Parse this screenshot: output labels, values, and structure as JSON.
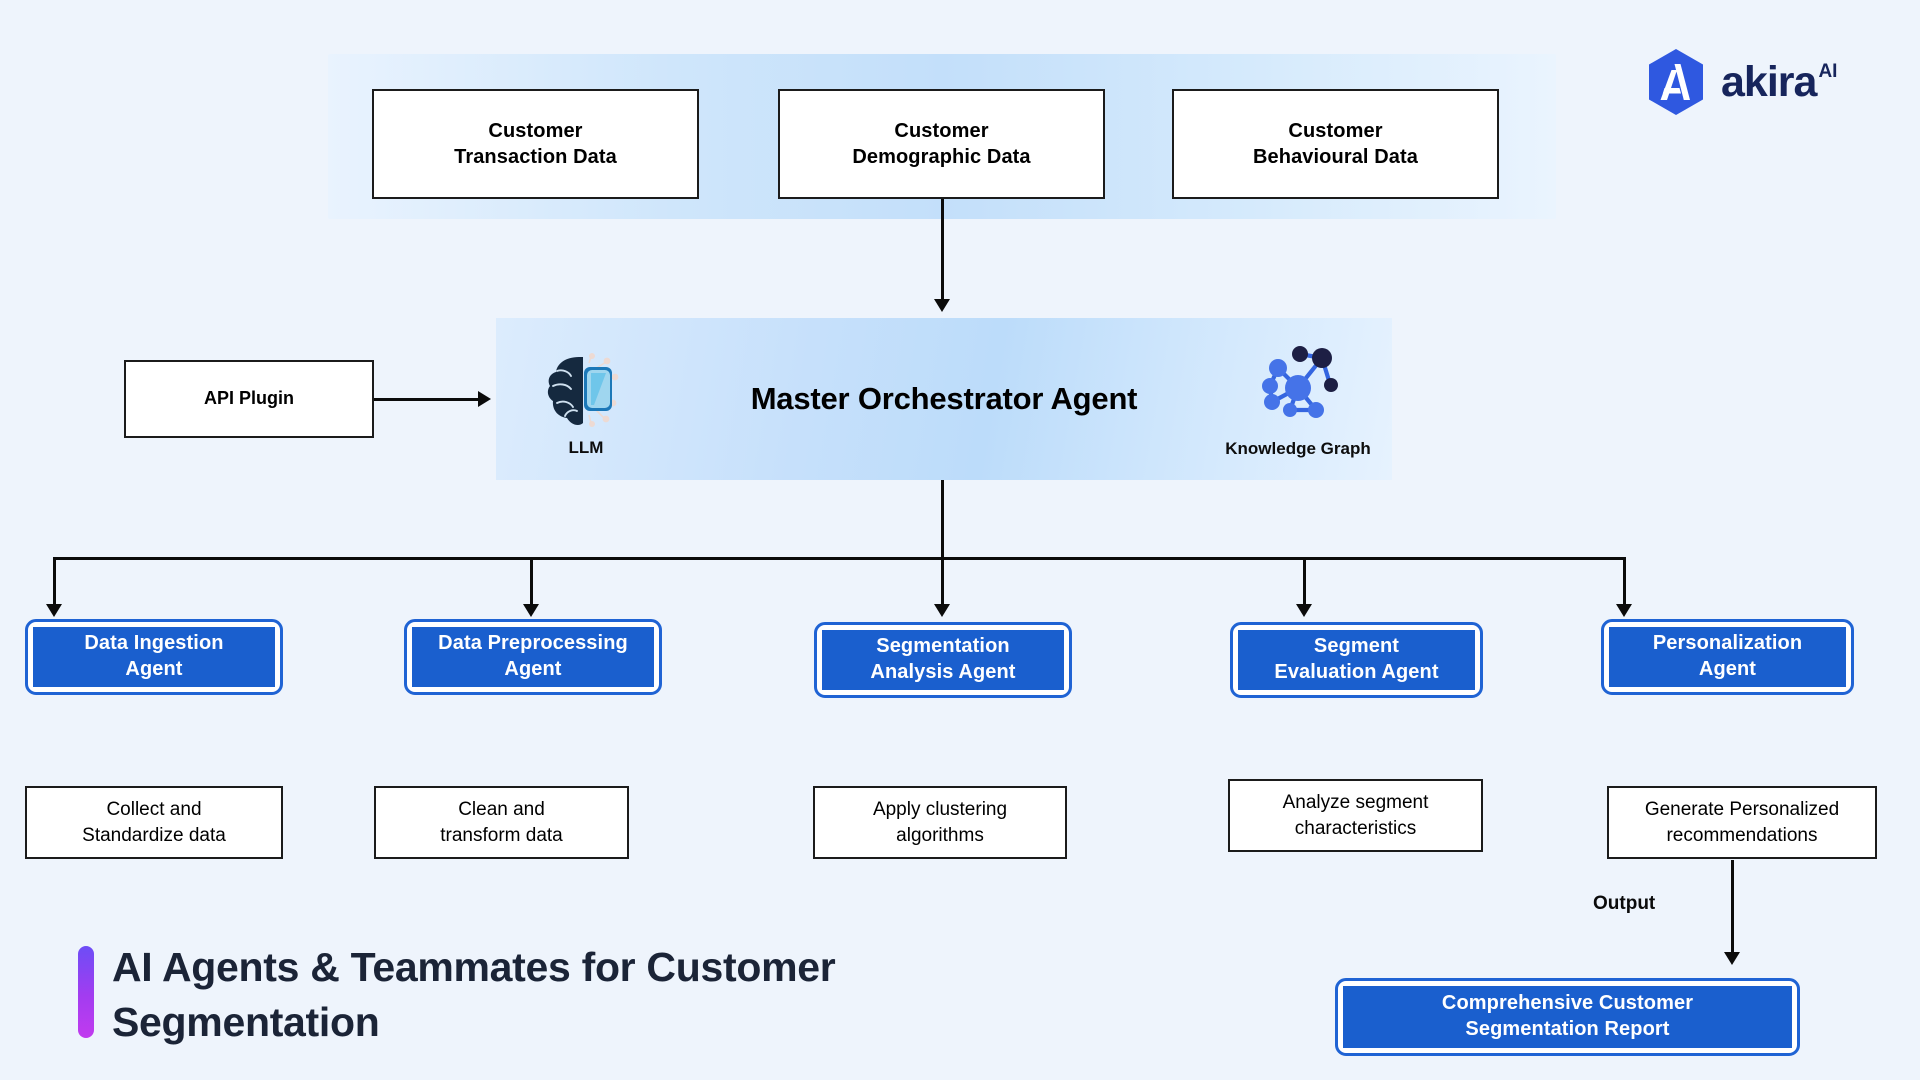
{
  "brand": {
    "name": "akira",
    "superscript": "AI",
    "logo_icon": "akira-hexagon-logo",
    "hex_color": "#2f58e0",
    "text_color": "#17255c"
  },
  "footer": {
    "title": "AI Agents & Teammates for Customer Segmentation",
    "accent_gradient_from": "#6d4df6",
    "accent_gradient_to": "#c13bef"
  },
  "data_sources": {
    "band_label": "customer-data-sources",
    "items": [
      {
        "line1": "Customer",
        "line2": "Transaction Data"
      },
      {
        "line1": "Customer",
        "line2": "Demographic Data"
      },
      {
        "line1": "Customer",
        "line2": "Behavioural Data"
      }
    ]
  },
  "api_plugin": {
    "label": "API Plugin"
  },
  "orchestrator": {
    "title": "Master Orchestrator Agent",
    "left_icon": {
      "name": "llm-brain-chip-icon",
      "caption": "LLM"
    },
    "right_icon": {
      "name": "knowledge-graph-icon",
      "caption": "Knowledge Graph"
    },
    "accent_color": "#1a5fce"
  },
  "agents": [
    {
      "line1": "Data Ingestion",
      "line2": "Agent",
      "desc_line1": "Collect and",
      "desc_line2": "Standardize data"
    },
    {
      "line1": "Data Preprocessing",
      "line2": "Agent",
      "desc_line1": "Clean and",
      "desc_line2": "transform data"
    },
    {
      "line1": "Segmentation",
      "line2": "Analysis Agent",
      "desc_line1": "Apply clustering",
      "desc_line2": "algorithms"
    },
    {
      "line1": "Segment",
      "line2": "Evaluation Agent",
      "desc_line1": "Analyze segment",
      "desc_line2": "characteristics"
    },
    {
      "line1": "Personalization",
      "line2": "Agent",
      "desc_line1": "Generate Personalized",
      "desc_line2": "recommendations"
    }
  ],
  "output": {
    "label": "Output",
    "report_line1": "Comprehensive Customer",
    "report_line2": "Segmentation Report"
  },
  "colors": {
    "page_background": "#eef4fc",
    "agent_fill": "#1a5fce",
    "agent_border": "#1f63d4",
    "line": "#0b0b0b",
    "box_border": "#1b1b1b"
  }
}
